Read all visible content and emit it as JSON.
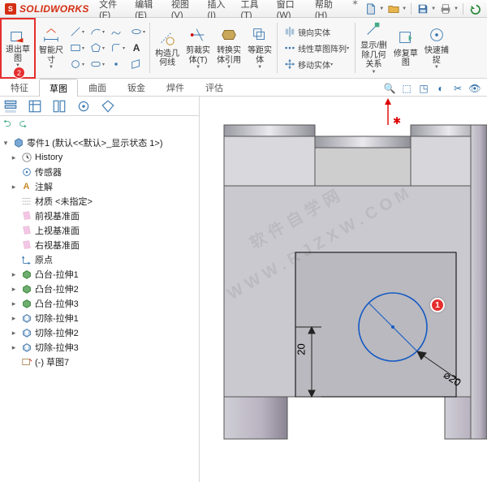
{
  "app": {
    "title": "SOLIDWORKS"
  },
  "menu": {
    "items": [
      "文件(F)",
      "编辑(E)",
      "视图(V)",
      "插入(I)",
      "工具(T)",
      "窗口(W)",
      "帮助(H)"
    ]
  },
  "ribbon": {
    "exit_sketch": "退出草\n图",
    "smart_dim": "智能尺\n寸",
    "constraint": "构造几\n何线",
    "trim": "剪裁实\n体(T)",
    "convert": "转换实\n体引用",
    "offset": "等距实\n体",
    "mirror": "镜向实体",
    "linear_pattern": "线性草图阵列",
    "move": "移动实体",
    "show_hide": "显示/删\n除几何\n关系",
    "repair": "修复草\n图",
    "quick_snap": "快速捕\n捉"
  },
  "tabs": {
    "t1": "特征",
    "t2": "草图",
    "t3": "曲面",
    "t4": "钣金",
    "t5": "焊件",
    "t6": "评估"
  },
  "tree": {
    "root": "零件1 (默认<<默认>_显示状态 1>)",
    "history": "History",
    "sensors": "传感器",
    "annot": "注解",
    "material": "材质 <未指定>",
    "front": "前视基准面",
    "top": "上视基准面",
    "right": "右视基准面",
    "origin": "原点",
    "ext1": "凸台-拉伸1",
    "ext2": "凸台-拉伸2",
    "ext3": "凸台-拉伸3",
    "cut1": "切除-拉伸1",
    "cut2": "切除-拉伸2",
    "cut3": "切除-拉伸3",
    "sketch7": "(-) 草图7"
  },
  "dims": {
    "d1": "20",
    "d2": "⌀20"
  },
  "badges": {
    "b1": "1",
    "b2": "2"
  },
  "watermark": "软件自学网\nWWW.RJZXW.COM"
}
